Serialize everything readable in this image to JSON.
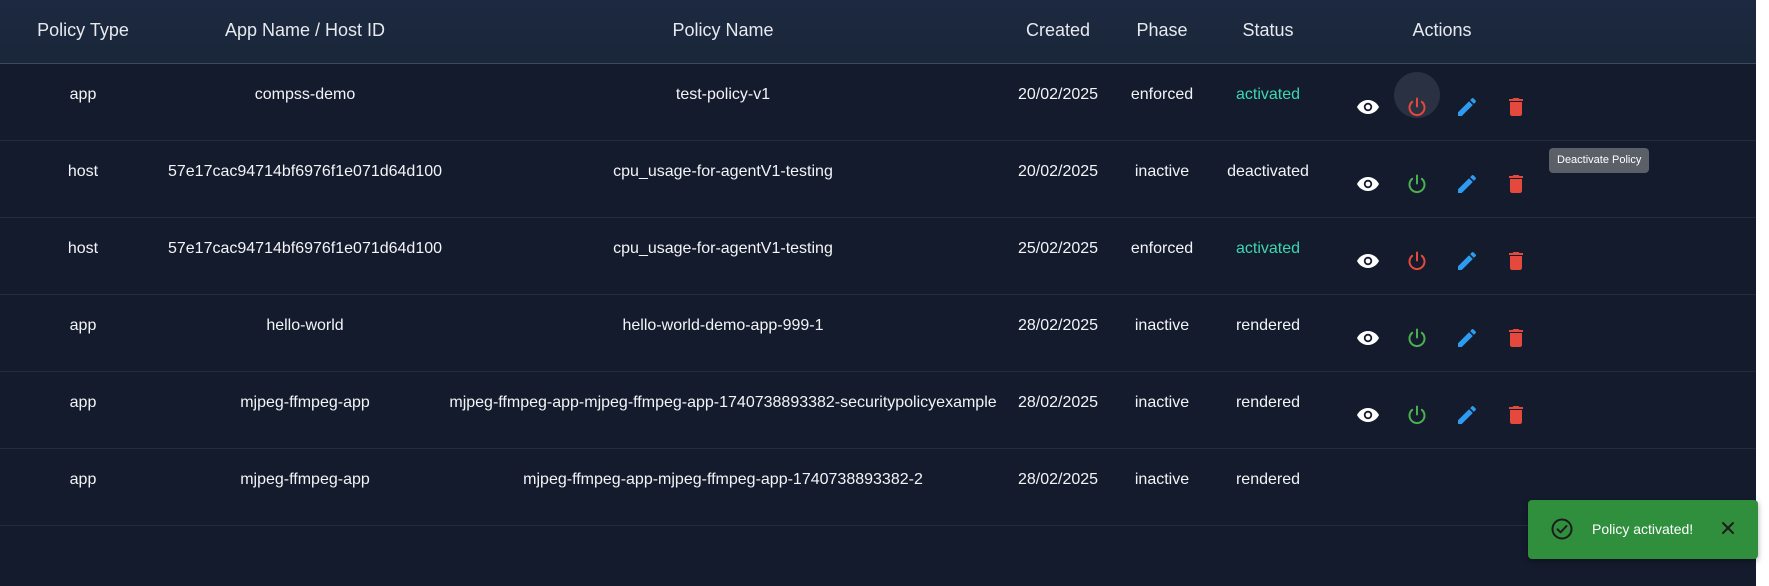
{
  "table": {
    "columns": [
      "Policy Type",
      "App Name / Host ID",
      "Policy Name",
      "Created",
      "Phase",
      "Status",
      "Actions"
    ],
    "rows": [
      {
        "type": "app",
        "name": "compss-demo",
        "policy": "test-policy-v1",
        "created": "20/02/2025",
        "phase": "enforced",
        "status": "activated",
        "power": "deactivate"
      },
      {
        "type": "host",
        "name": "57e17cac94714bf6976f1e071d64d100",
        "policy": "cpu_usage-for-agentV1-testing",
        "created": "20/02/2025",
        "phase": "inactive",
        "status": "deactivated",
        "power": "activate"
      },
      {
        "type": "host",
        "name": "57e17cac94714bf6976f1e071d64d100",
        "policy": "cpu_usage-for-agentV1-testing",
        "created": "25/02/2025",
        "phase": "enforced",
        "status": "activated",
        "power": "deactivate"
      },
      {
        "type": "app",
        "name": "hello-world",
        "policy": "hello-world-demo-app-999-1",
        "created": "28/02/2025",
        "phase": "inactive",
        "status": "rendered",
        "power": "activate"
      },
      {
        "type": "app",
        "name": "mjpeg-ffmpeg-app",
        "policy": "mjpeg-ffmpeg-app-mjpeg-ffmpeg-app-1740738893382-securitypolicyexample",
        "created": "28/02/2025",
        "phase": "inactive",
        "status": "rendered",
        "power": "activate"
      },
      {
        "type": "app",
        "name": "mjpeg-ffmpeg-app",
        "policy": "mjpeg-ffmpeg-app-mjpeg-ffmpeg-app-1740738893382-2",
        "created": "28/02/2025",
        "phase": "inactive",
        "status": "rendered",
        "power": "activate"
      }
    ]
  },
  "tooltip": {
    "text": "Deactivate Policy"
  },
  "toast": {
    "message": "Policy activated!"
  },
  "icons": {
    "view": "eye-icon",
    "power": "power-icon",
    "edit": "pencil-icon",
    "delete": "trash-icon",
    "toast_check": "check-circle-icon",
    "toast_close": "close-icon"
  },
  "colors": {
    "activated": "#3dd6b0",
    "power_deactivate": "#e5483c",
    "power_activate": "#4caf50",
    "edit": "#2d9bf0",
    "delete": "#e5483c",
    "toast_bg": "#2f8f3c"
  }
}
